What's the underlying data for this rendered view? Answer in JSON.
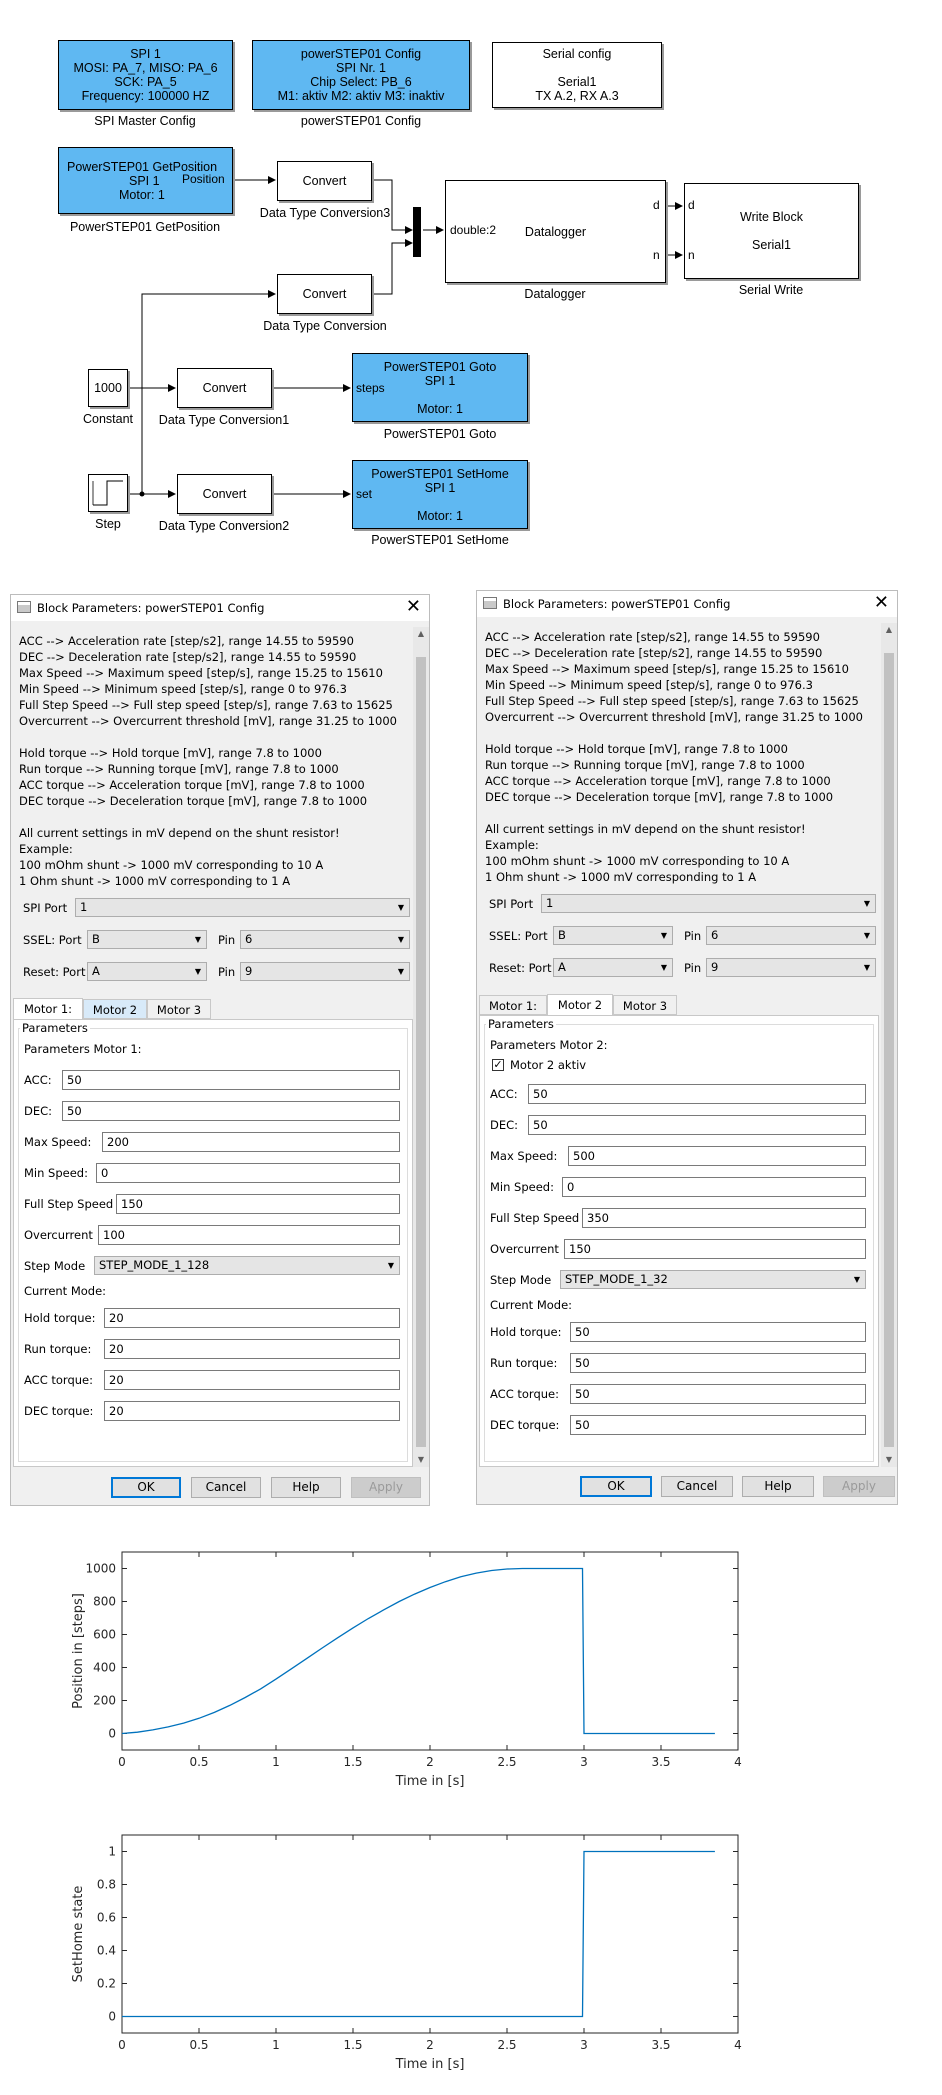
{
  "diagram": {
    "blocks": {
      "spi1": {
        "lines": [
          "SPI 1",
          "MOSI: PA_7, MISO: PA_6",
          "SCK: PA_5",
          "Frequency: 100000 HZ"
        ],
        "caption": "SPI Master Config"
      },
      "ps_config": {
        "lines": [
          "powerSTEP01 Config",
          "SPI Nr. 1",
          "Chip Select: PB_6",
          "M1: aktiv M2: aktiv M3: inaktiv"
        ],
        "caption": "powerSTEP01 Config"
      },
      "serial_config": {
        "lines": [
          "Serial config",
          "",
          "Serial1",
          "TX A.2, RX A.3"
        ]
      },
      "getpos": {
        "lines": [
          "PowerSTEP01 GetPosition",
          "SPI 1",
          "Motor: 1"
        ],
        "port_out": "Position",
        "caption": "PowerSTEP01 GetPosition"
      },
      "convert3": {
        "label": "Convert",
        "caption": "Data Type Conversion3"
      },
      "convert0": {
        "label": "Convert",
        "caption": "Data Type Conversion"
      },
      "convert1": {
        "label": "Convert",
        "caption": "Data Type Conversion1"
      },
      "convert2": {
        "label": "Convert",
        "caption": "Data Type Conversion2"
      },
      "datalogger": {
        "port_in": "double:2",
        "label": "Datalogger",
        "port_d": "d",
        "port_n": "n",
        "caption": "Datalogger"
      },
      "write_block": {
        "lines": [
          "Write Block",
          "",
          "Serial1"
        ],
        "port_d": "d",
        "port_n": "n",
        "caption": "Serial Write"
      },
      "constant": {
        "value": "1000",
        "caption": "Constant"
      },
      "step": {
        "caption": "Step"
      },
      "goto": {
        "lines": [
          "PowerSTEP01 Goto",
          "SPI 1",
          "",
          "Motor: 1"
        ],
        "port_in": "steps",
        "caption": "PowerSTEP01 Goto"
      },
      "sethome": {
        "lines": [
          "PowerSTEP01 SetHome",
          "SPI 1",
          "",
          "Motor: 1"
        ],
        "port_in": "set",
        "caption": "PowerSTEP01 SetHome"
      }
    }
  },
  "dialog1": {
    "title": "Block Parameters: powerSTEP01 Config",
    "desc1": "ACC --> Acceleration rate [step/s2], range 14.55 to 59590\nDEC --> Deceleration rate [step/s2], range 14.55 to 59590\nMax Speed --> Maximum speed [step/s], range 15.25 to 15610\nMin Speed --> Minimum speed [step/s], range 0 to 976.3\nFull Step Speed --> Full step speed [step/s], range 7.63 to 15625\nOvercurrent --> Overcurrent threshold [mV], range 31.25 to 1000",
    "desc2": "Hold torque --> Hold torque [mV], range 7.8 to 1000\nRun torque --> Running torque [mV], range 7.8 to 1000\nACC torque --> Acceleration torque [mV], range 7.8 to 1000\nDEC torque --> Deceleration torque [mV], range 7.8 to 1000",
    "desc3": "All current settings in mV depend on the shunt resistor!\nExample:\n100 mOhm shunt -> 1000 mV corresponding to 10 A\n1 Ohm shunt -> 1000 mV corresponding to 1 A",
    "spi_port_label": "SPI Port",
    "spi_port": "1",
    "ssel_label": "SSEL: Port",
    "ssel_port": "B",
    "pin_label": "Pin",
    "ssel_pin": "6",
    "reset_label": "Reset: Port",
    "reset_port": "A",
    "reset_pin_label": "Pin",
    "reset_pin": "9",
    "tabs": [
      "Motor 1:",
      "Motor 2",
      "Motor 3"
    ],
    "group_title": "Parameters",
    "params_title": "Parameters Motor 1:",
    "acc_label": "ACC:",
    "acc": "50",
    "dec_label": "DEC:",
    "dec": "50",
    "max_speed_label": "Max Speed:",
    "max_speed": "200",
    "min_speed_label": "Min Speed:",
    "min_speed": "0",
    "full_step_label": "Full Step Speed",
    "full_step": "150",
    "overcurrent_label": "Overcurrent",
    "overcurrent": "100",
    "step_mode_label": "Step Mode",
    "step_mode": "STEP_MODE_1_128",
    "current_mode": "Current Mode:",
    "hold_label": "Hold torque:",
    "hold": "20",
    "run_label": "Run torque:",
    "run": "20",
    "acc_torque_label": "ACC torque:",
    "acc_torque": "20",
    "dec_torque_label": "DEC torque:",
    "dec_torque": "20",
    "ok": "OK",
    "cancel": "Cancel",
    "help": "Help",
    "apply": "Apply"
  },
  "dialog2": {
    "title": "Block Parameters: powerSTEP01 Config",
    "desc1": "ACC --> Acceleration rate [step/s2], range 14.55 to 59590\nDEC --> Deceleration rate [step/s2], range 14.55 to 59590\nMax Speed --> Maximum speed [step/s], range 15.25 to 15610\nMin Speed --> Minimum speed [step/s], range 0 to 976.3\nFull Step Speed --> Full step speed [step/s], range 7.63 to 15625\nOvercurrent --> Overcurrent threshold [mV], range 31.25 to 1000",
    "desc2": "Hold torque --> Hold torque [mV], range 7.8 to 1000\nRun torque --> Running torque [mV], range 7.8 to 1000\nACC torque --> Acceleration torque [mV], range 7.8 to 1000\nDEC torque --> Deceleration torque [mV], range 7.8 to 1000",
    "desc3": "All current settings in mV depend on the shunt resistor!\nExample:\n100 mOhm shunt -> 1000 mV corresponding to 10 A\n1 Ohm shunt -> 1000 mV corresponding to 1 A",
    "spi_port_label": "SPI Port",
    "spi_port": "1",
    "ssel_label": "SSEL: Port",
    "ssel_port": "B",
    "pin_label": "Pin",
    "ssel_pin": "6",
    "reset_label": "Reset: Port",
    "reset_port": "A",
    "reset_pin_label": "Pin",
    "reset_pin": "9",
    "tabs": [
      "Motor 1:",
      "Motor 2",
      "Motor 3"
    ],
    "group_title": "Parameters",
    "params_title": "Parameters Motor 2:",
    "aktiv_label": "Motor 2 aktiv",
    "aktiv_checked": true,
    "acc_label": "ACC:",
    "acc": "50",
    "dec_label": "DEC:",
    "dec": "50",
    "max_speed_label": "Max Speed:",
    "max_speed": "500",
    "min_speed_label": "Min Speed:",
    "min_speed": "0",
    "full_step_label": "Full Step Speed",
    "full_step": "350",
    "overcurrent_label": "Overcurrent",
    "overcurrent": "150",
    "step_mode_label": "Step Mode",
    "step_mode": "STEP_MODE_1_32",
    "current_mode": "Current Mode:",
    "hold_label": "Hold torque:",
    "hold": "50",
    "run_label": "Run torque:",
    "run": "50",
    "acc_torque_label": "ACC torque:",
    "acc_torque": "50",
    "dec_torque_label": "DEC torque:",
    "dec_torque": "50",
    "ok": "OK",
    "cancel": "Cancel",
    "help": "Help",
    "apply": "Apply"
  },
  "chart_data": [
    {
      "type": "line",
      "xlabel": "Time in [s]",
      "ylabel": "Position in [steps]",
      "xlim": [
        0,
        4
      ],
      "ylim": [
        -100,
        1100
      ],
      "xticks": [
        "0",
        "0.5",
        "1",
        "1.5",
        "2",
        "2.5",
        "3",
        "3.5",
        "4"
      ],
      "yticks": [
        "0",
        "200",
        "400",
        "600",
        "800",
        "1000"
      ],
      "line_color": "#0072bd",
      "x": [
        0,
        0.1,
        0.2,
        0.3,
        0.4,
        0.5,
        0.6,
        0.7,
        0.8,
        0.9,
        1.0,
        1.1,
        1.2,
        1.3,
        1.4,
        1.5,
        1.6,
        1.7,
        1.8,
        1.9,
        2.0,
        2.1,
        2.2,
        2.3,
        2.4,
        2.5,
        2.6,
        2.7,
        2.8,
        2.9,
        2.99,
        3.0,
        3.85
      ],
      "y": [
        0,
        8,
        22,
        40,
        63,
        92,
        128,
        170,
        218,
        270,
        330,
        392,
        455,
        518,
        580,
        640,
        697,
        750,
        800,
        845,
        885,
        920,
        950,
        972,
        988,
        997,
        1000,
        1000,
        1000,
        1000,
        1000,
        0,
        0
      ]
    },
    {
      "type": "line",
      "xlabel": "Time in [s]",
      "ylabel": "SetHome state",
      "xlim": [
        0,
        4
      ],
      "ylim": [
        -0.1,
        1.1
      ],
      "xticks": [
        "0",
        "0.5",
        "1",
        "1.5",
        "2",
        "2.5",
        "3",
        "3.5",
        "4"
      ],
      "yticks": [
        "0",
        "0.2",
        "0.4",
        "0.6",
        "0.8",
        "1"
      ],
      "line_color": "#0072bd",
      "x": [
        0,
        2.99,
        3.0,
        3.85
      ],
      "y": [
        0,
        0,
        1,
        1
      ]
    }
  ]
}
